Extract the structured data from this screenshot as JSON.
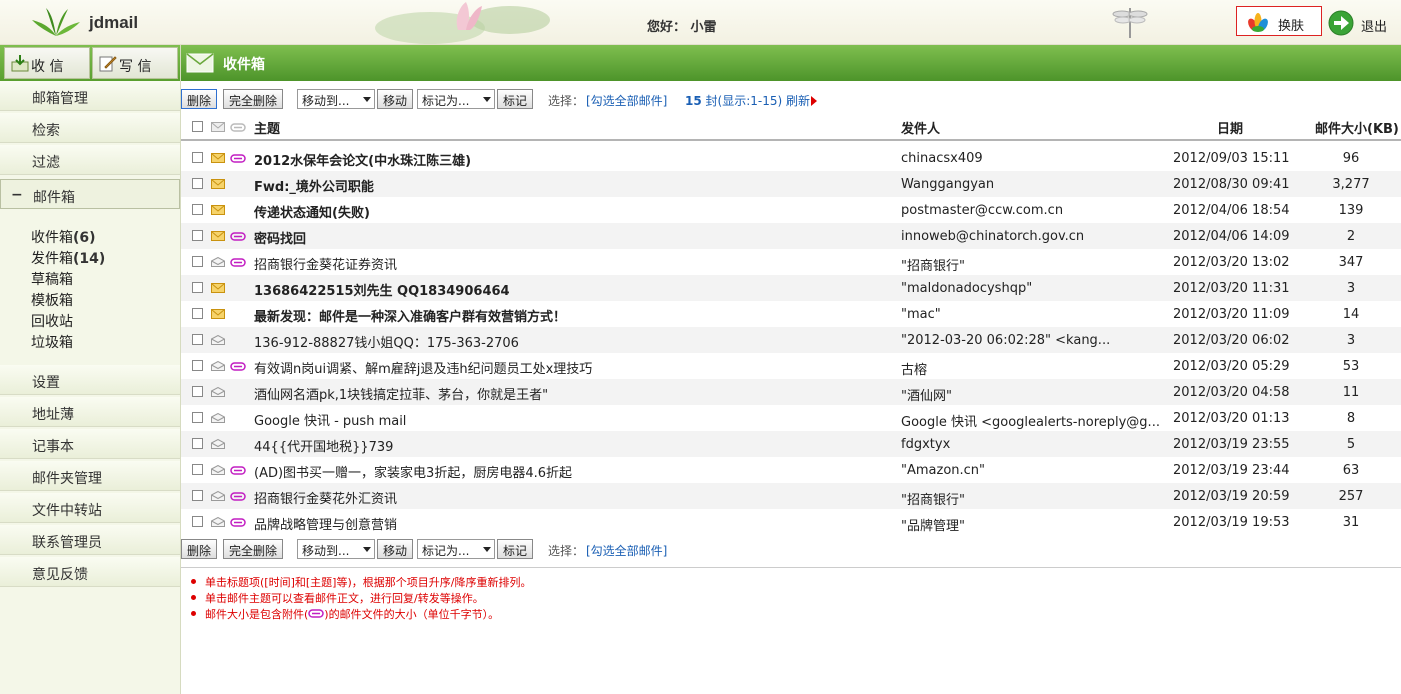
{
  "header": {
    "brand": "jdmail",
    "greeting": "您好：",
    "user": "小雷",
    "skin_label": "换肤",
    "exit_label": "退出"
  },
  "sidebar": {
    "receive_label": "收 信",
    "compose_label": "写 信",
    "menu_top": [
      "邮箱管理",
      "检索",
      "过滤"
    ],
    "mailbox_group": "邮件箱",
    "mailbox_group_toggle": "−",
    "folders": [
      {
        "name": "收件箱",
        "count": "(6)"
      },
      {
        "name": "发件箱",
        "count": "(14)"
      },
      {
        "name": "草稿箱",
        "count": ""
      },
      {
        "name": "模板箱",
        "count": ""
      },
      {
        "name": "回收站",
        "count": ""
      },
      {
        "name": "垃圾箱",
        "count": ""
      }
    ],
    "menu_bottom": [
      "设置",
      "地址薄",
      "记事本",
      "邮件夹管理",
      "文件中转站",
      "联系管理员",
      "意见反馈"
    ]
  },
  "main": {
    "title": "收件箱",
    "toolbar": {
      "delete": "删除",
      "delete_all": "完全删除",
      "move_to": "移动到...",
      "move": "移动",
      "mark_as": "标记为...",
      "mark": "标记",
      "select_label": "选择：",
      "select_all": "[勾选全部邮件]",
      "count_num": "15",
      "count_text": "封(显示:1-15)",
      "refresh": "刷新"
    },
    "columns": {
      "subject": "主题",
      "from": "发件人",
      "date": "日期",
      "size": "邮件大小(KB)"
    },
    "emails": [
      {
        "subject": "2012水保年会论文(中水珠江陈三雄)",
        "from": "chinacsx409",
        "date": "2012/09/03 15:11",
        "size": "96",
        "unread": true,
        "attach": true
      },
      {
        "subject": "Fwd:_境外公司职能",
        "from": "Wanggangyan",
        "date": "2012/08/30 09:41",
        "size": "3,277",
        "unread": true,
        "attach": false
      },
      {
        "subject": "传递状态通知(失败)",
        "from": "postmaster@ccw.com.cn",
        "date": "2012/04/06 18:54",
        "size": "139",
        "unread": true,
        "attach": false
      },
      {
        "subject": "密码找回",
        "from": "innoweb@chinatorch.gov.cn",
        "date": "2012/04/06 14:09",
        "size": "2",
        "unread": true,
        "attach": true
      },
      {
        "subject": "招商银行金葵花证券资讯",
        "from": "\"招商银行\"",
        "date": "2012/03/20 13:02",
        "size": "347",
        "unread": false,
        "attach": true
      },
      {
        "subject": "13686422515刘先生 QQ1834906464",
        "from": "\"maldonadocyshqp\"",
        "date": "2012/03/20 11:31",
        "size": "3",
        "unread": true,
        "attach": false
      },
      {
        "subject": "最新发现：邮件是一种深入准确客户群有效营销方式！",
        "from": "\"mac\"",
        "date": "2012/03/20 11:09",
        "size": "14",
        "unread": true,
        "attach": false
      },
      {
        "subject": "136-912-88827钱小姐QQ：175-363-2706",
        "from": "\"2012-03-20 06:02:28\" <kang...",
        "date": "2012/03/20 06:02",
        "size": "3",
        "unread": false,
        "attach": false
      },
      {
        "subject": "有效调n岗ui调紧、解m雇辞j退及违h纪问题员工处x理技巧",
        "from": "古榕",
        "date": "2012/03/20 05:29",
        "size": "53",
        "unread": false,
        "attach": true
      },
      {
        "subject": "酒仙网名酒pk,1块钱搞定拉菲、茅台，你就是王者\"",
        "from": "\"酒仙网\"",
        "date": "2012/03/20 04:58",
        "size": "11",
        "unread": false,
        "attach": false
      },
      {
        "subject": "Google 快讯 - push mail",
        "from": "Google 快讯 <googlealerts-noreply@g...",
        "date": "2012/03/20 01:13",
        "size": "8",
        "unread": false,
        "attach": false
      },
      {
        "subject": "44{{代开国地税}}739",
        "from": "fdgxtyx",
        "date": "2012/03/19 23:55",
        "size": "5",
        "unread": false,
        "attach": false
      },
      {
        "subject": "(AD)图书买一赠一，家装家电3折起，厨房电器4.6折起",
        "from": "\"Amazon.cn\"",
        "date": "2012/03/19 23:44",
        "size": "63",
        "unread": false,
        "attach": true
      },
      {
        "subject": "招商银行金葵花外汇资讯",
        "from": "\"招商银行\"",
        "date": "2012/03/19 20:59",
        "size": "257",
        "unread": false,
        "attach": true
      },
      {
        "subject": "品牌战略管理与创意营销",
        "from": "\"品牌管理\"",
        "date": "2012/03/19 19:53",
        "size": "31",
        "unread": false,
        "attach": true
      }
    ],
    "notes": [
      "单击标题项([时间]和[主题]等)，根据那个项目升序/降序重新排列。",
      "单击邮件主题可以查看邮件正文，进行回复/转发等操作。",
      "邮件大小是包含附件(",
      ")的邮件文件的大小（单位千字节）。"
    ]
  },
  "colors": {
    "green": "#5a9f2f",
    "link": "#1a5fb4",
    "note": "#dd0000"
  }
}
